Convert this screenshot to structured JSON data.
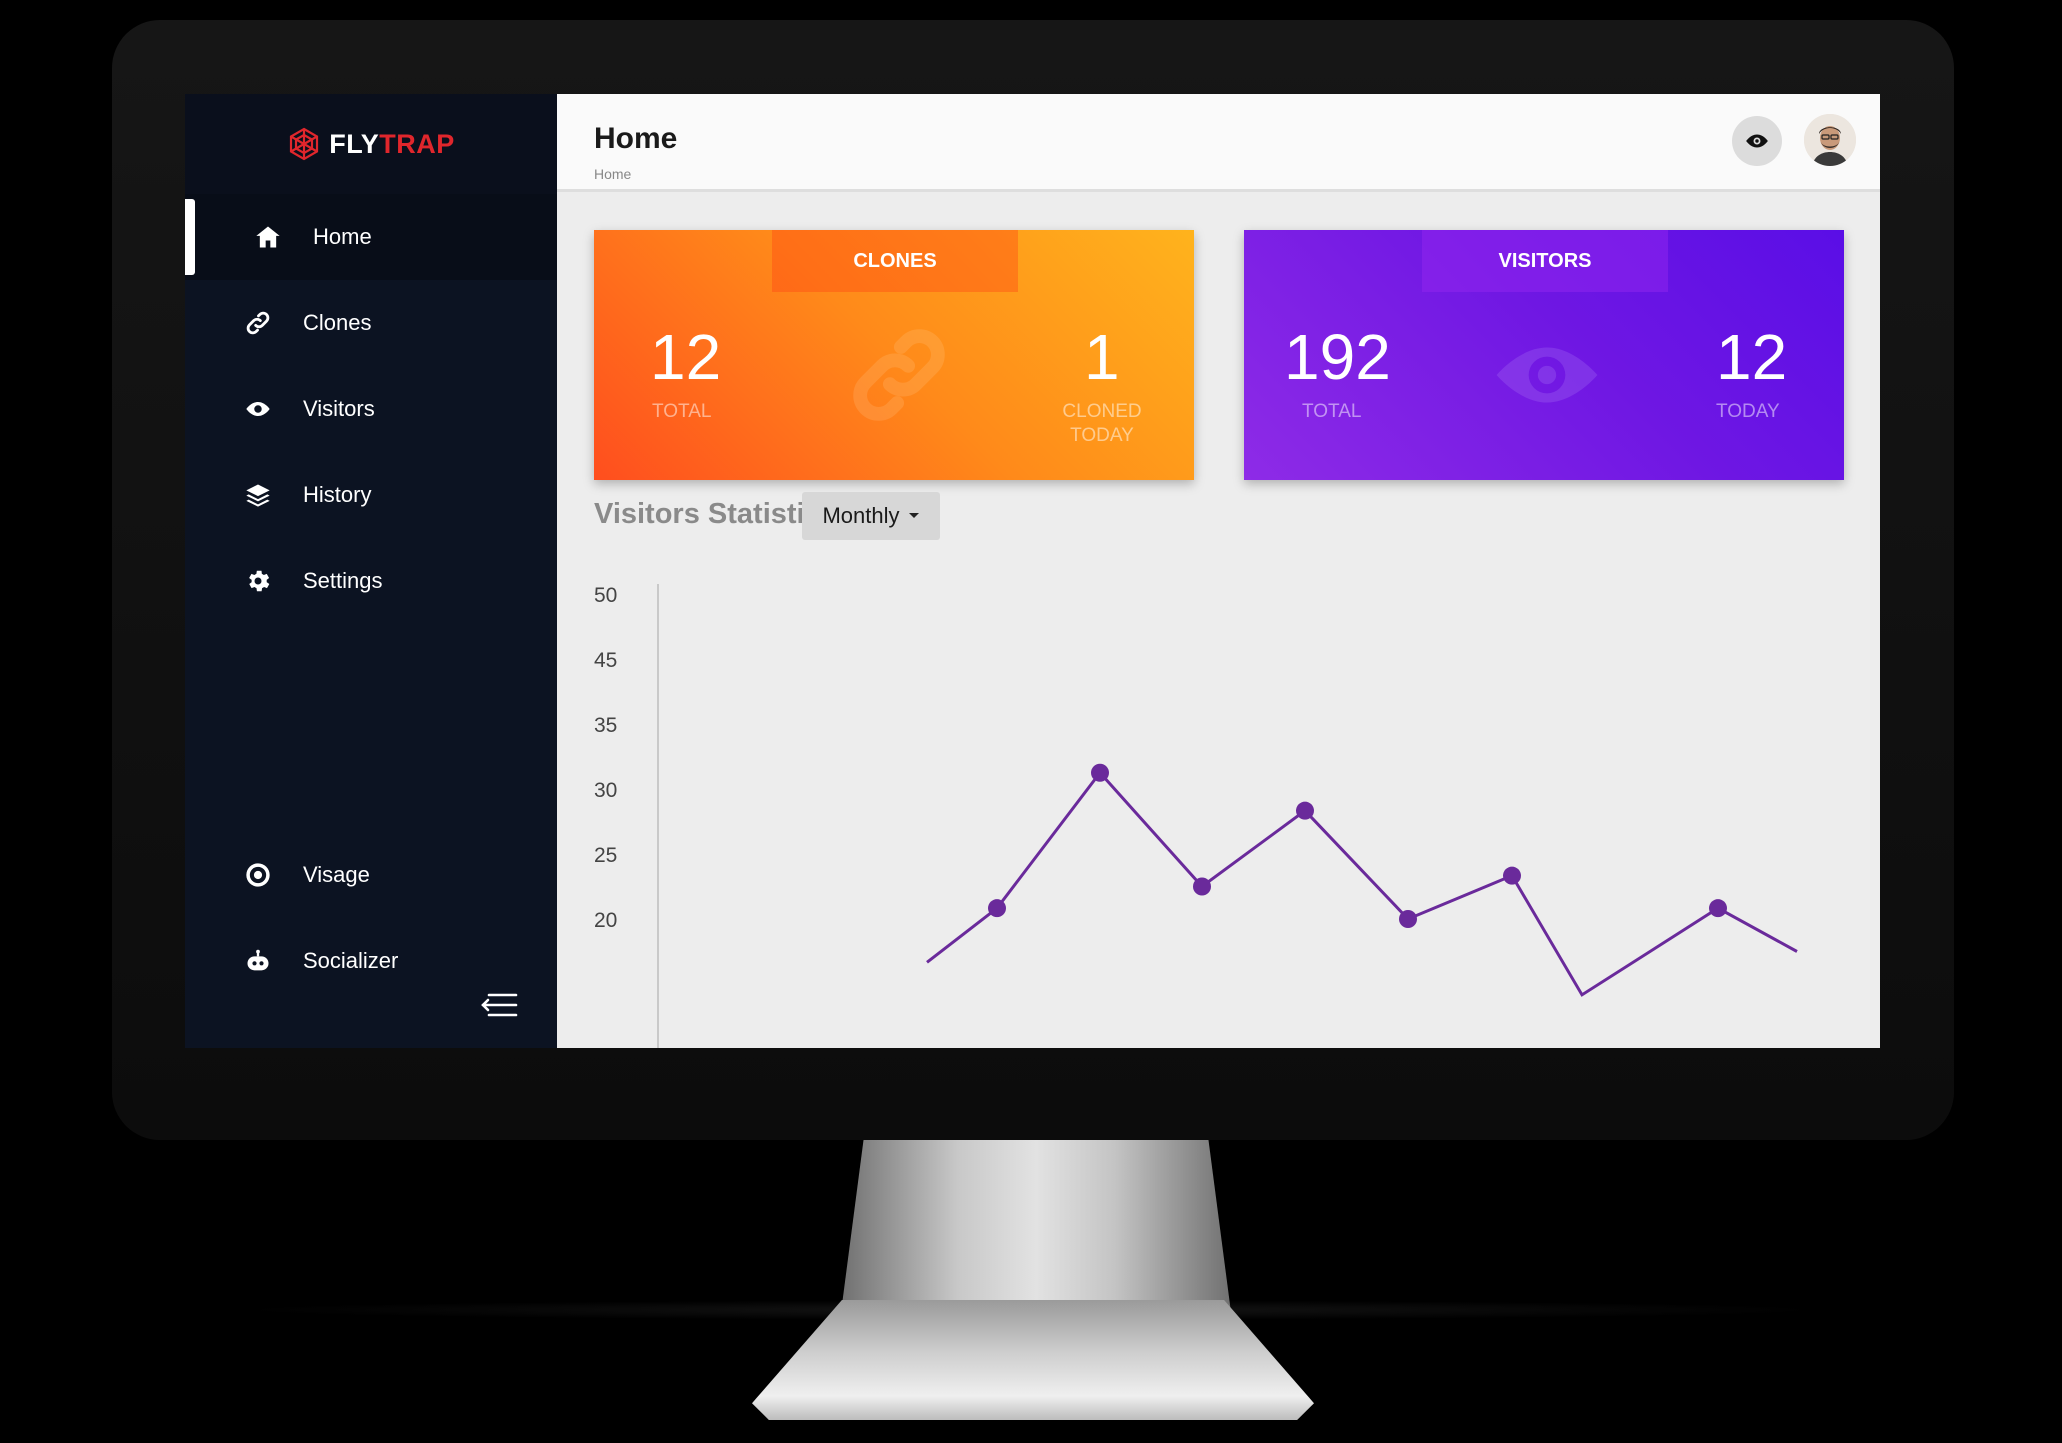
{
  "brand": {
    "part1": "FLY",
    "part2": "TRAP",
    "accent": "#e0262c"
  },
  "sidebar": {
    "items": [
      {
        "label": "Home",
        "icon": "home-icon",
        "active": true
      },
      {
        "label": "Clones",
        "icon": "link-icon"
      },
      {
        "label": "Visitors",
        "icon": "eye-icon"
      },
      {
        "label": "History",
        "icon": "layers-icon"
      },
      {
        "label": "Settings",
        "icon": "gear-icon"
      }
    ],
    "bottom_items": [
      {
        "label": "Visage",
        "icon": "target-icon"
      },
      {
        "label": "Socializer",
        "icon": "robot-icon"
      }
    ],
    "collapse_icon": "collapse-menu-icon"
  },
  "header": {
    "title": "Home",
    "breadcrumb": "Home",
    "eye_icon": "eye-icon",
    "avatar": "user-avatar"
  },
  "cards": {
    "clones": {
      "title": "CLONES",
      "total": "12",
      "total_label": "TOTAL",
      "today": "1",
      "today_label": "CLONED TODAY",
      "icon": "link-icon"
    },
    "visitors": {
      "title": "VISITORS",
      "total": "192",
      "total_label": "TOTAL",
      "today": "12",
      "today_label": "TODAY",
      "icon": "eye-icon"
    }
  },
  "stats": {
    "title": "Visitors Statistics",
    "period": "Monthly"
  },
  "chart_data": {
    "type": "line",
    "color": "#6a2a9b",
    "y_ticks": [
      "50",
      "45",
      "35",
      "30",
      "25",
      "20"
    ],
    "ylim": [
      20,
      50
    ],
    "series": [
      {
        "values": [
          16,
          21,
          33.5,
          23,
          30,
          20,
          24,
          13,
          21,
          17
        ]
      }
    ]
  }
}
